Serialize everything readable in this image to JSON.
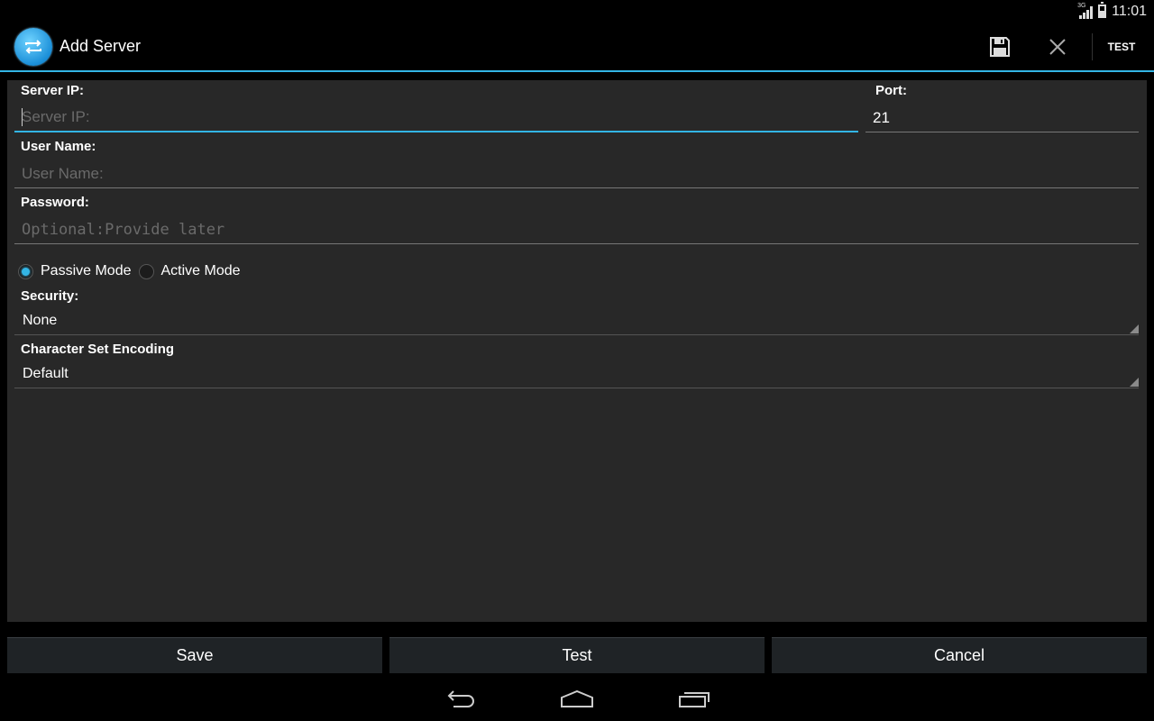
{
  "status_bar": {
    "network": "3G",
    "time": "11:01"
  },
  "action_bar": {
    "title": "Add Server",
    "app_icon": "sync-arrows-icon",
    "actions": [
      {
        "icon": "floppy-save-icon"
      },
      {
        "icon": "close-icon"
      },
      {
        "label": "TEST"
      }
    ]
  },
  "form": {
    "server_ip": {
      "label": "Server IP:",
      "placeholder": "Server IP:",
      "value": ""
    },
    "port": {
      "label": "Port:",
      "value": "21"
    },
    "user_name": {
      "label": "User Name:",
      "placeholder": "User Name:",
      "value": ""
    },
    "password": {
      "label": "Password:",
      "placeholder": "Optional:Provide later",
      "value": ""
    },
    "mode": {
      "options": [
        {
          "label": "Passive Mode",
          "checked": true
        },
        {
          "label": "Active Mode",
          "checked": false
        }
      ]
    },
    "security": {
      "label": "Security:",
      "selected": "None"
    },
    "encoding": {
      "label": "Character Set Encoding",
      "selected": "Default"
    }
  },
  "buttons": {
    "save": "Save",
    "test": "Test",
    "cancel": "Cancel"
  },
  "nav_bar": {
    "icons": [
      "back-icon",
      "home-icon",
      "recents-icon"
    ]
  },
  "colors": {
    "accent": "#33b5e5",
    "panel": "#282828",
    "background": "#000000"
  }
}
